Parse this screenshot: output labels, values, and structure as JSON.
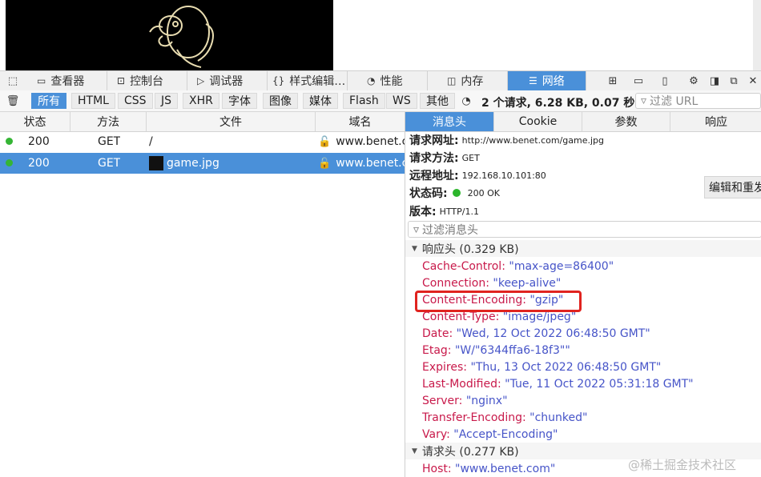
{
  "toolbar": {
    "tabs": [
      {
        "label": "查看器",
        "icon": "inspector-icon"
      },
      {
        "label": "控制台",
        "icon": "console-icon"
      },
      {
        "label": "调试器",
        "icon": "debugger-icon"
      },
      {
        "label": "样式编辑…",
        "icon": "style-editor-icon"
      },
      {
        "label": "性能",
        "icon": "performance-icon"
      },
      {
        "label": "内存",
        "icon": "memory-icon"
      },
      {
        "label": "网络",
        "icon": "network-icon"
      }
    ]
  },
  "filters": {
    "buttons": [
      "所有",
      "HTML",
      "CSS",
      "JS",
      "XHR",
      "字体",
      "图像",
      "媒体",
      "Flash",
      "WS",
      "其他"
    ],
    "summary": "2 个请求, 6.28 KB, 0.07 秒",
    "url_placeholder": "过滤 URL"
  },
  "table": {
    "headers": [
      "状态",
      "方法",
      "文件",
      "域名"
    ],
    "rows": [
      {
        "status": "200",
        "method": "GET",
        "file": "/",
        "domain": "www.benet.co"
      },
      {
        "status": "200",
        "method": "GET",
        "file": "game.jpg",
        "domain": "www.benet.co"
      }
    ]
  },
  "details": {
    "tabs": [
      "消息头",
      "Cookie",
      "参数",
      "响应"
    ],
    "summary": {
      "url_label": "请求网址:",
      "url_value": "http://www.benet.com/game.jpg",
      "method_label": "请求方法:",
      "method_value": "GET",
      "remote_label": "远程地址:",
      "remote_value": "192.168.10.101:80",
      "status_label": "状态码:",
      "status_value": "200 OK",
      "version_label": "版本:",
      "version_value": "HTTP/1.1"
    },
    "edit_button": "编辑和重发",
    "header_filter_placeholder": "过滤消息头",
    "response_section": "响应头 (0.329 KB)",
    "response_headers": [
      {
        "name": "Cache-Control:",
        "value": "\"max-age=86400\""
      },
      {
        "name": "Connection:",
        "value": "\"keep-alive\""
      },
      {
        "name": "Content-Encoding:",
        "value": "\"gzip\""
      },
      {
        "name": "Content-Type:",
        "value": "\"image/jpeg\""
      },
      {
        "name": "Date:",
        "value": "\"Wed, 12 Oct 2022 06:48:50 GMT\""
      },
      {
        "name": "Etag:",
        "value": "\"W/\"6344ffa6-18f3\"\""
      },
      {
        "name": "Expires:",
        "value": "\"Thu, 13 Oct 2022 06:48:50 GMT\""
      },
      {
        "name": "Last-Modified:",
        "value": "\"Tue, 11 Oct 2022 05:31:18 GMT\""
      },
      {
        "name": "Server:",
        "value": "\"nginx\""
      },
      {
        "name": "Transfer-Encoding:",
        "value": "\"chunked\""
      },
      {
        "name": "Vary:",
        "value": "\"Accept-Encoding\""
      }
    ],
    "request_section": "请求头 (0.277 KB)",
    "request_headers": [
      {
        "name": "Host:",
        "value": "\"www.benet.com\""
      }
    ]
  },
  "watermark": "@稀土掘金技术社区",
  "colors": {
    "accent": "#4a90d9",
    "header_name": "#c8194a",
    "header_value": "#4654c8",
    "highlight": "#e0231f"
  }
}
